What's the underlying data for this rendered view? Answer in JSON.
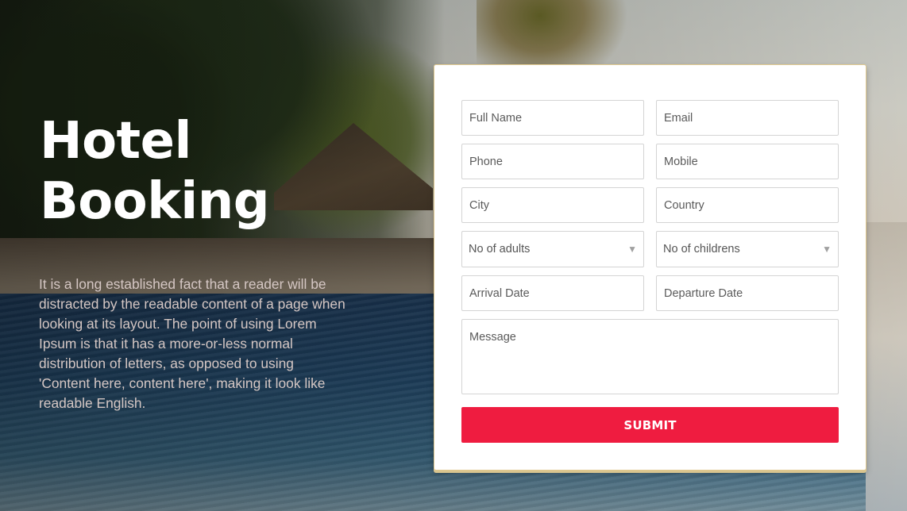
{
  "hero": {
    "title_line1": "Hotel",
    "title_line2": "Booking",
    "description": "It is a long established fact that a reader will be distracted by the readable content of a page when looking at its layout. The point of using Lorem Ipsum is that it has a more-or-less normal distribution of letters, as opposed to using 'Content here, content here', making it look like readable English."
  },
  "form": {
    "full_name": {
      "placeholder": "Full Name",
      "value": ""
    },
    "email": {
      "placeholder": "Email",
      "value": ""
    },
    "phone": {
      "placeholder": "Phone",
      "value": ""
    },
    "mobile": {
      "placeholder": "Mobile",
      "value": ""
    },
    "city": {
      "placeholder": "City",
      "value": ""
    },
    "country": {
      "placeholder": "Country",
      "value": ""
    },
    "adults": {
      "selected": "No of adults",
      "icon": "chevron-down-icon",
      "glyph": "▼"
    },
    "children": {
      "selected": "No of childrens",
      "icon": "chevron-down-icon",
      "glyph": "▼"
    },
    "arrival_date": {
      "placeholder": "Arrival Date",
      "value": ""
    },
    "departure_date": {
      "placeholder": "Departure Date",
      "value": ""
    },
    "message": {
      "placeholder": "Message",
      "value": ""
    },
    "submit_label": "SUBMIT"
  },
  "colors": {
    "submit": "#ef1c40",
    "card_border": "#e0c98f",
    "title": "#ffffff",
    "description": "#d5c7c4"
  }
}
